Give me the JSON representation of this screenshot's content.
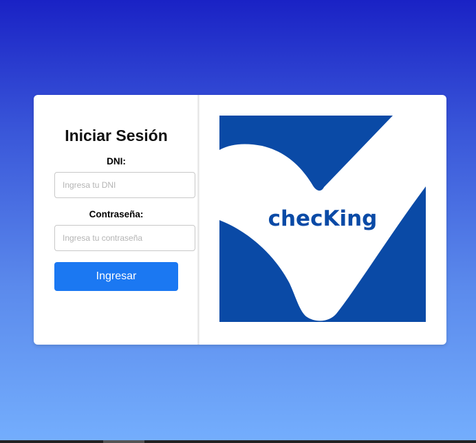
{
  "login": {
    "title": "Iniciar Sesión",
    "dni_label": "DNI:",
    "dni_placeholder": "Ingresa tu DNI",
    "dni_value": "",
    "password_label": "Contraseña:",
    "password_placeholder": "Ingresa tu contraseña",
    "password_value": "",
    "submit_label": "Ingresar"
  },
  "brand": {
    "logo_text": "checKing",
    "logo_icon": "checkmark-logo-icon",
    "primary_color": "#0a4aa6",
    "button_color": "#1b78f2"
  }
}
